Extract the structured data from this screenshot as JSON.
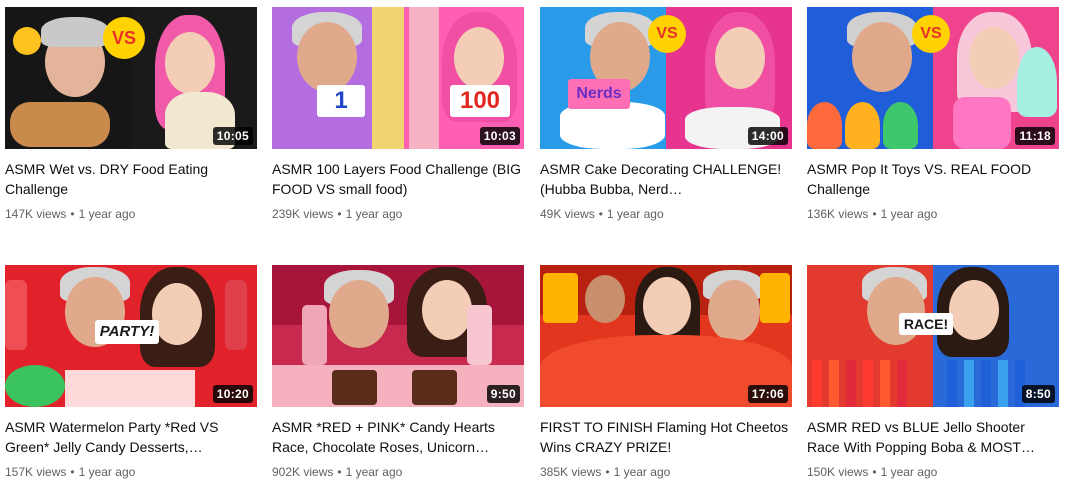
{
  "videos": [
    {
      "title": "ASMR Wet vs. DRY Food Eating Challenge",
      "views": "147K views",
      "age": "1 year ago",
      "duration": "10:05",
      "thumb_text": "VS"
    },
    {
      "title": "ASMR 100 Layers Food Challenge (BIG FOOD VS small food)",
      "views": "239K views",
      "age": "1 year ago",
      "duration": "10:03",
      "thumb_left": "1",
      "thumb_right": "100"
    },
    {
      "title": "ASMR Cake Decorating CHALLENGE! (Hubba Bubba, Nerd…",
      "views": "49K views",
      "age": "1 year ago",
      "duration": "14:00",
      "thumb_text": "VS",
      "thumb_brand": "Nerds"
    },
    {
      "title": "ASMR Pop It Toys VS. REAL FOOD Challenge",
      "views": "136K views",
      "age": "1 year ago",
      "duration": "11:18",
      "thumb_text": "VS"
    },
    {
      "title": "ASMR Watermelon Party *Red VS Green* Jelly Candy Desserts,…",
      "views": "157K views",
      "age": "1 year ago",
      "duration": "10:20",
      "thumb_text": "PARTY!"
    },
    {
      "title": "ASMR *RED + PINK* Candy Hearts Race, Chocolate Roses, Unicorn…",
      "views": "902K views",
      "age": "1 year ago",
      "duration": "9:50"
    },
    {
      "title": "FIRST TO FINISH Flaming Hot Cheetos Wins CRAZY PRIZE!",
      "views": "385K views",
      "age": "1 year ago",
      "duration": "17:06"
    },
    {
      "title": "ASMR RED vs BLUE Jello Shooter Race With Popping Boba & MOST…",
      "views": "150K views",
      "age": "1 year ago",
      "duration": "8:50",
      "thumb_text": "RACE!"
    }
  ],
  "meta_separator": "•"
}
